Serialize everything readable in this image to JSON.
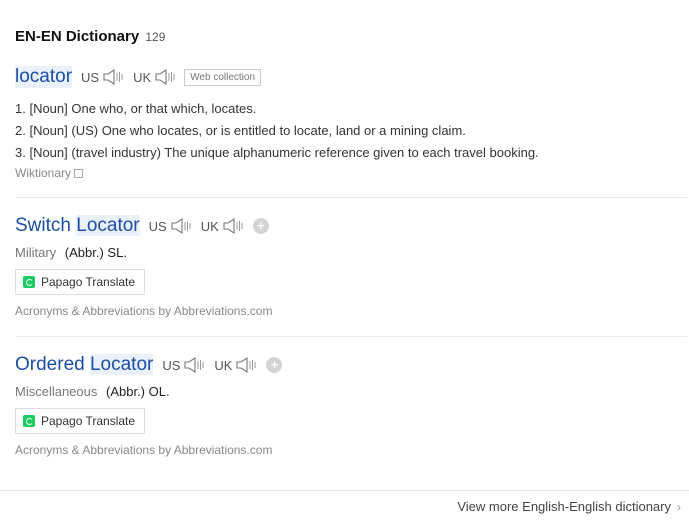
{
  "section": {
    "title": "EN-EN Dictionary",
    "count": "129"
  },
  "entries": [
    {
      "headword": "locator",
      "us_label": "US",
      "uk_label": "UK",
      "tag": "Web collection",
      "definitions": [
        "1. [Noun] One who, or that which, locates.",
        "2. [Noun] (US) One who locates, or is entitled to locate, land or a mining claim.",
        "3. [Noun] (travel industry) The unique alphanumeric reference given to each travel booking."
      ],
      "source": "Wiktionary"
    },
    {
      "headword_part1": "Switch",
      "headword_part2": "Locator",
      "us_label": "US",
      "uk_label": "UK",
      "category": "Military",
      "meaning": "(Abbr.) SL.",
      "translate_button": "Papago Translate",
      "source": "Acronyms & Abbreviations by Abbreviations.com"
    },
    {
      "headword_part1": "Ordered",
      "headword_part2": "Locator",
      "us_label": "US",
      "uk_label": "UK",
      "category": "Miscellaneous",
      "meaning": "(Abbr.) OL.",
      "translate_button": "Papago Translate",
      "source": "Acronyms & Abbreviations by Abbreviations.com"
    }
  ],
  "footer": {
    "more_label": "View more English-English dictionary"
  },
  "colors": {
    "headword": "#1a4fa3",
    "highlight": "#eaf1fb",
    "papago": "#19ce60"
  }
}
